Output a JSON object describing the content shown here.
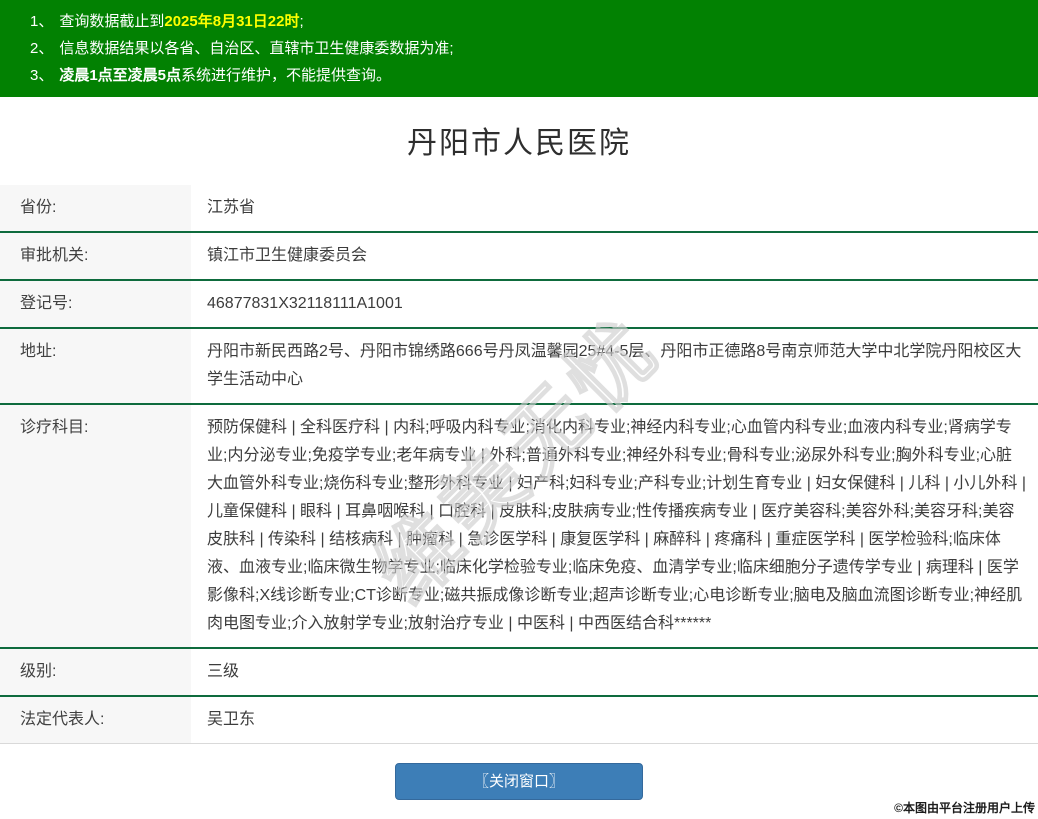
{
  "colors": {
    "banner_green": "#028102",
    "divider_green": "#0e6b3d",
    "label_bg": "#f7f7f7",
    "button_blue": "#3d7eb7",
    "notice_highlight_yellow": "#ffff00"
  },
  "banner": {
    "notices": [
      {
        "num": "1、",
        "pre": "查询数据截止到",
        "bold": "2025年8月31日22时",
        "post": ";",
        "bold_style": "yellow"
      },
      {
        "num": "2、",
        "pre": "信息数据结果以各省、自治区、直辖市卫生健康委数据为准;",
        "bold": "",
        "post": "",
        "bold_style": "white"
      },
      {
        "num": "3、",
        "pre": "",
        "bold": "凌晨1点至凌晨5点",
        "post": "系统进行维护，不能提供查询。",
        "bold_style": "white"
      }
    ]
  },
  "header": {
    "title": "丹阳市人民医院"
  },
  "table": {
    "rows": [
      {
        "label": "省份:",
        "value": "江苏省"
      },
      {
        "label": "审批机关:",
        "value": "镇江市卫生健康委员会"
      },
      {
        "label": "登记号:",
        "value": "46877831X32118111A1001"
      },
      {
        "label": "地址:",
        "value": "丹阳市新民西路2号、丹阳市锦绣路666号丹凤温馨园25#4-5层、丹阳市正德路8号南京师范大学中北学院丹阳校区大学生活动中心"
      },
      {
        "label": "诊疗科目:",
        "value": "预防保健科 | 全科医疗科 | 内科;呼吸内科专业;消化内科专业;神经内科专业;心血管内科专业;血液内科专业;肾病学专业;内分泌专业;免疫学专业;老年病专业 | 外科;普通外科专业;神经外科专业;骨科专业;泌尿外科专业;胸外科专业;心脏大血管外科专业;烧伤科专业;整形外科专业 | 妇产科;妇科专业;产科专业;计划生育专业 | 妇女保健科 | 儿科 | 小儿外科 | 儿童保健科 | 眼科 | 耳鼻咽喉科 | 口腔科 | 皮肤科;皮肤病专业;性传播疾病专业 | 医疗美容科;美容外科;美容牙科;美容皮肤科 | 传染科 | 结核病科 | 肿瘤科 | 急诊医学科 | 康复医学科 | 麻醉科 | 疼痛科 | 重症医学科 | 医学检验科;临床体液、血液专业;临床微生物学专业;临床化学检验专业;临床免疫、血清学专业;临床细胞分子遗传学专业 | 病理科 | 医学影像科;X线诊断专业;CT诊断专业;磁共振成像诊断专业;超声诊断专业;心电诊断专业;脑电及脑血流图诊断专业;神经肌肉电图专业;介入放射学专业;放射治疗专业 | 中医科 | 中西医结合科******"
      },
      {
        "label": "级别:",
        "value": "三级"
      },
      {
        "label": "法定代表人:",
        "value": "吴卫东"
      }
    ]
  },
  "footer": {
    "close_button_label": "〖关闭窗口〗",
    "credit": "©本图由平台注册用户上传"
  },
  "watermark": {
    "text": "维美无忧"
  }
}
